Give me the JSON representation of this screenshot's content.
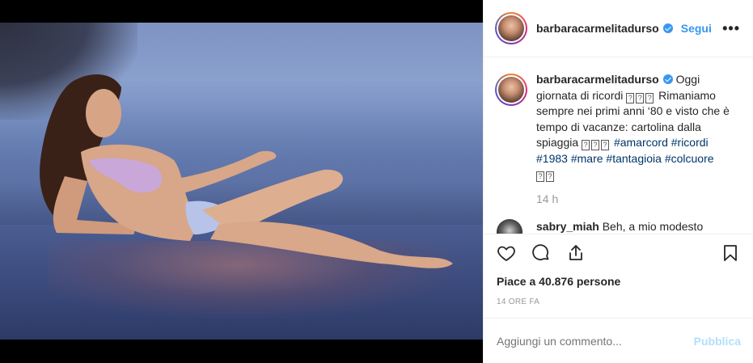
{
  "post": {
    "username": "barbaracarmelitadurso",
    "follow_label": "Segui",
    "more_label": "•••",
    "caption": {
      "username": "barbaracarmelitadurso",
      "part1": "Oggi giornata di ricordi",
      "box1": "?",
      "part2": "Rimaniamo sempre nei primi anni ‘80 e visto che è tempo di vacanze: cartolina dalla spiaggia",
      "hashtags": [
        "#amarcord",
        "#ricordi",
        "#1983",
        "#mare",
        "#tantagioia",
        "#colcuore"
      ]
    },
    "time": "14 h",
    "comment": {
      "username": "sabry_miah",
      "text": "Beh, a mio modesto"
    },
    "likes_prefix": "Piace a",
    "likes_count": "40.876",
    "likes_suffix": "persone",
    "ago": "14 ORE FA",
    "add_comment_placeholder": "Aggiungi un commento...",
    "publish_label": "Pubblica"
  },
  "icons": {
    "like": "heart-icon",
    "comment": "comment-icon",
    "share": "share-icon",
    "save": "bookmark-icon",
    "verified": "verified-badge-icon",
    "options": "more-options-icon"
  },
  "colors": {
    "link_blue": "#3897f0",
    "hashtag": "#003569",
    "muted": "#999999",
    "publish_disabled": "#b2dffc"
  }
}
